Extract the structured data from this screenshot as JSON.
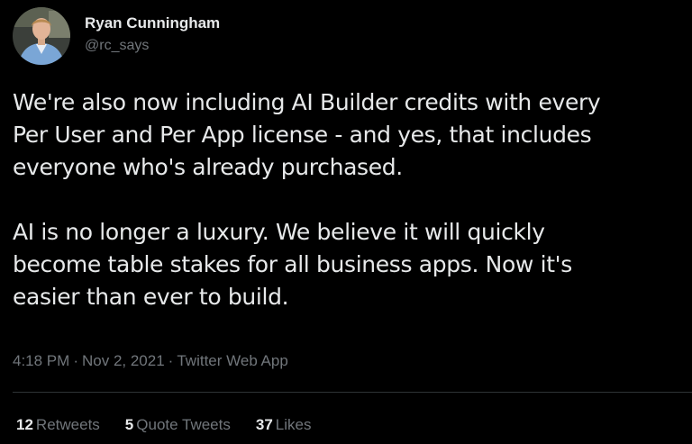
{
  "author": {
    "display_name": "Ryan Cunningham",
    "handle": "@rc_says"
  },
  "tweet": {
    "paragraphs": [
      [
        "We're also now including AI Builder credits with every",
        "Per User and Per App license - and yes, that includes",
        "everyone who's already purchased."
      ],
      [
        "AI is no longer a luxury. We believe it will quickly",
        "become table stakes for all business apps. Now it's",
        "easier than ever to build."
      ]
    ],
    "time": "4:18 PM",
    "date": "Nov 2, 2021",
    "source": "Twitter Web App",
    "separator": "·"
  },
  "stats": {
    "retweets_count": "12",
    "retweets_label": "Retweets",
    "quote_tweets_count": "5",
    "quote_tweets_label": "Quote Tweets",
    "likes_count": "37",
    "likes_label": "Likes"
  },
  "colors": {
    "background": "#000000",
    "primary_text": "#e7e9ea",
    "secondary_text": "#71767b",
    "divider": "#2f3336"
  }
}
